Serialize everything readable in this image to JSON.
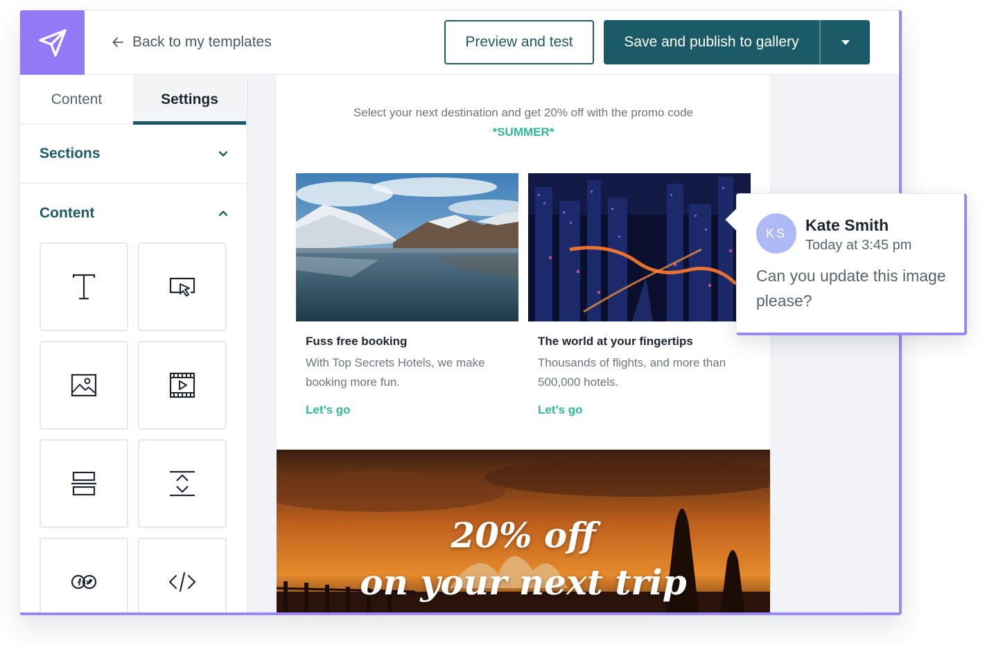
{
  "topbar": {
    "back_label": "Back to my templates",
    "preview_label": "Preview and test",
    "publish_label": "Save and publish to gallery"
  },
  "sidebar": {
    "tabs": [
      {
        "label": "Content",
        "active": false
      },
      {
        "label": "Settings",
        "active": true
      }
    ],
    "sections_label": "Sections",
    "content_label": "Content",
    "blocks": [
      {
        "icon": "text-icon"
      },
      {
        "icon": "button-icon"
      },
      {
        "icon": "image-icon"
      },
      {
        "icon": "video-icon"
      },
      {
        "icon": "divider-icon"
      },
      {
        "icon": "spacer-icon"
      },
      {
        "icon": "social-icon"
      },
      {
        "icon": "code-icon"
      }
    ]
  },
  "email": {
    "promo_text": "Select your next destination and get 20% off with the promo code",
    "promo_code": "*SUMMER*",
    "cards": [
      {
        "title": "Fuss free booking",
        "description": "With Top Secrets Hotels, we make booking more fun.",
        "link": "Let’s go"
      },
      {
        "title": "The world at your fingertips",
        "description": "Thousands of flights, and more than 500,000 hotels.",
        "link": "Let’s go"
      }
    ],
    "banner": {
      "line1": "20% off",
      "line2": "on your next trip"
    }
  },
  "comment": {
    "initials": "KS",
    "author": "Kate Smith",
    "time": "Today at 3:45 pm",
    "body": "Can you update this image please?"
  },
  "colors": {
    "brand_purple": "#9479f7",
    "primary_teal": "#1b5a67",
    "accent_green": "#2fb897"
  }
}
